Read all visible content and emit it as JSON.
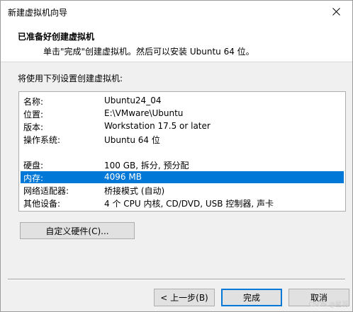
{
  "window": {
    "title": "新建虚拟机向导",
    "close_icon": "close-icon"
  },
  "header": {
    "title": "已准备好创建虚拟机",
    "subtitle": "单击\"完成\"创建虚拟机。然后可以安装 Ubuntu 64 位。"
  },
  "settings": {
    "label": "将使用下列设置创建虚拟机:",
    "rows": [
      {
        "key": "名称:",
        "value": "Ubuntu24_04"
      },
      {
        "key": "位置:",
        "value": "E:\\VMware\\Ubuntu"
      },
      {
        "key": "版本:",
        "value": "Workstation 17.5 or later"
      },
      {
        "key": "操作系统:",
        "value": "Ubuntu 64 位"
      },
      {
        "key": "硬盘:",
        "value": "100 GB, 拆分, 预分配"
      },
      {
        "key": "内存:",
        "value": "4096 MB"
      },
      {
        "key": "网络适配器:",
        "value": "桥接模式 (自动)"
      },
      {
        "key": "其他设备:",
        "value": "4 个 CPU 内核, CD/DVD, USB 控制器, 声卡"
      }
    ],
    "selected_row": "内存:"
  },
  "buttons": {
    "customize": "自定义硬件(C)...",
    "back": "< 上一步(B)",
    "finish": "完成",
    "cancel": "取消"
  },
  "colors": {
    "selection": "#0078d7",
    "default_button_border": "#0078d7"
  },
  "watermark": "CSDN @星羽"
}
